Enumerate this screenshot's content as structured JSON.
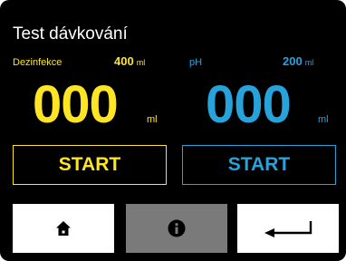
{
  "header": {
    "title": "Test dávkování"
  },
  "colors": {
    "disinfection": "#fee524",
    "ph": "#27a3dc",
    "background": "#000000"
  },
  "disinfection": {
    "label": "Dezinfekce",
    "amount": "400",
    "amount_unit": "ml",
    "value": "000",
    "value_unit": "ml",
    "start_label": "START"
  },
  "ph": {
    "label": "pH",
    "amount": "200",
    "amount_unit": "ml",
    "value": "000",
    "value_unit": "ml",
    "start_label": "START"
  },
  "bottom_bar": {
    "buttons": [
      {
        "icon": "home-icon",
        "state": "enabled"
      },
      {
        "icon": "info-icon",
        "state": "disabled"
      },
      {
        "icon": "return-arrow-icon",
        "state": "enabled"
      }
    ]
  }
}
